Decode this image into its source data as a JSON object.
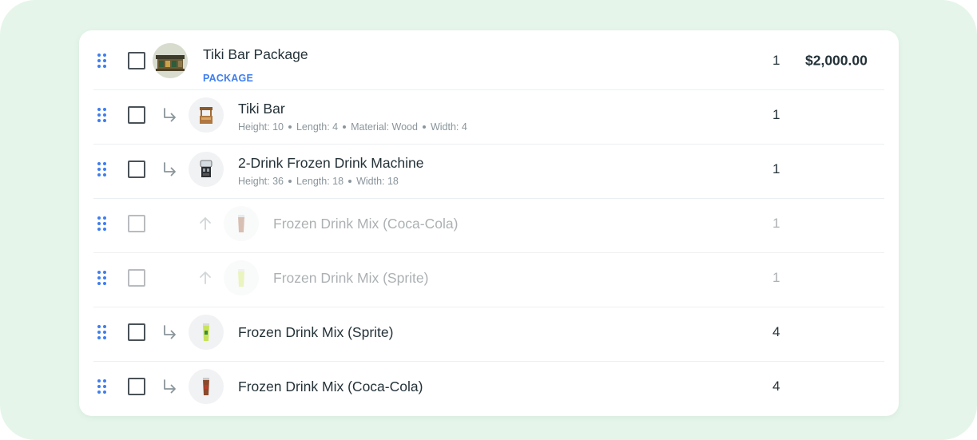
{
  "colors": {
    "accent": "#3d7ef0",
    "background": "#e5f5ea",
    "text": "#243238",
    "muted": "#8a959b"
  },
  "rows": [
    {
      "name": "Tiki Bar Package",
      "tag": "PACKAGE",
      "qty": "1",
      "price": "$2,000.00",
      "thumb": "tiki-bar-photo"
    },
    {
      "name": "Tiki Bar",
      "details": [
        "Height: 10",
        "Length: 4",
        "Material: Wood",
        "Width: 4"
      ],
      "qty": "1",
      "icon": "child-arrow-icon",
      "thumb": "tiki-bar-stand"
    },
    {
      "name": "2-Drink Frozen Drink Machine",
      "details": [
        "Height: 36",
        "Length: 18",
        "Width: 18"
      ],
      "qty": "1",
      "icon": "child-arrow-icon",
      "thumb": "frozen-drink-machine"
    },
    {
      "name": "Frozen Drink Mix (Coca-Cola)",
      "qty": "1",
      "icon": "up-arrow-icon",
      "state": "disabled",
      "thumb": "cola-cup"
    },
    {
      "name": "Frozen Drink Mix (Sprite)",
      "qty": "1",
      "icon": "up-arrow-icon",
      "state": "disabled",
      "thumb": "sprite-cup"
    },
    {
      "name": "Frozen Drink Mix (Sprite)",
      "qty": "4",
      "icon": "child-arrow-icon",
      "thumb": "sprite-cup"
    },
    {
      "name": "Frozen Drink Mix (Coca-Cola)",
      "qty": "4",
      "icon": "child-arrow-icon",
      "thumb": "cola-cup"
    }
  ]
}
